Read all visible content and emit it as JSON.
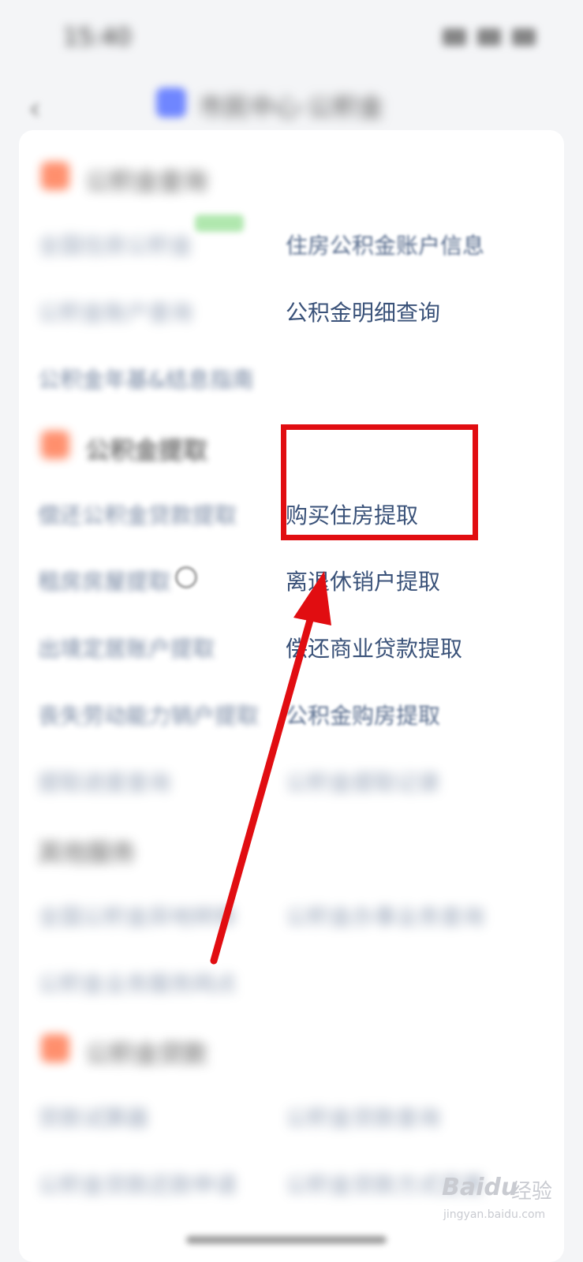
{
  "status_bar": {
    "time": "15:40"
  },
  "nav": {
    "title": "市民中心·公积金"
  },
  "sections": {
    "query": {
      "title": "公积金查询",
      "items": {
        "national": "全国住房公积金",
        "account_info": "住房公积金账户信息",
        "account_query": "公积金账户查询",
        "detail_query": "公积金明细查询",
        "guide": "公积金年基&结息指南"
      }
    },
    "withdraw": {
      "title": "公积金提取",
      "items": {
        "loan_withdraw": "偿还公积金贷款提取",
        "buy_house": "购买住房提取",
        "rent": "租房房屋提取",
        "retire": "离退休销户提取",
        "transfer": "出境定居账户提取",
        "commercial_loan": "偿还商业贷款提取",
        "labor": "丧失劳动能力销户提取",
        "house_purchase": "公积金购房提取",
        "progress": "提取进度查询",
        "records": "公积金提取记录"
      }
    },
    "other": {
      "title": "其他服务",
      "items": {
        "national_transfer": "全国公积金异地转移",
        "handling": "公积金办事业务查询",
        "outlet": "公积金业务服务网点"
      }
    },
    "loan": {
      "title": "公积金贷款",
      "items": {
        "calculator": "贷款试算器",
        "loan_query": "公积金贷款查询",
        "apply": "公积金贷款还款申请",
        "repay_change": "公积金贷款方式变更"
      }
    }
  },
  "watermark": {
    "logo": "Bai",
    "logo2": "du",
    "cn": "经验",
    "url": "jingyan.baidu.com"
  },
  "colors": {
    "annotation": "#e10d11",
    "link": "#3a5279",
    "section_icon": "#ff6a3d"
  }
}
